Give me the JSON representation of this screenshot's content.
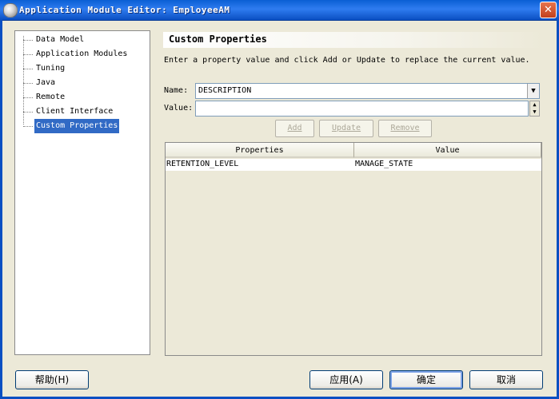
{
  "window": {
    "title": "Application Module Editor: EmployeeAM",
    "close_glyph": "✕"
  },
  "nav": {
    "items": [
      {
        "label": "Data Model"
      },
      {
        "label": "Application Modules"
      },
      {
        "label": "Tuning"
      },
      {
        "label": "Java"
      },
      {
        "label": "Remote"
      },
      {
        "label": "Client Interface"
      },
      {
        "label": "Custom Properties",
        "selected": true
      }
    ]
  },
  "section": {
    "title": "Custom Properties",
    "instructions": "Enter a property value and click Add or Update to replace the current value."
  },
  "form": {
    "name_label": "Name:",
    "name_value": "DESCRIPTION",
    "value_label": "Value:",
    "value_value": "",
    "dropdown_glyph": "▼",
    "spin_up_glyph": "▲",
    "spin_down_glyph": "▼"
  },
  "actions": {
    "add": "Add",
    "update": "Update",
    "remove": "Remove"
  },
  "table": {
    "columns": [
      "Properties",
      "Value"
    ],
    "rows": [
      [
        "RETENTION_LEVEL",
        "MANAGE_STATE"
      ]
    ]
  },
  "footer": {
    "help": "帮助(H)",
    "apply": "应用(A)",
    "ok": "确定",
    "cancel": "取消"
  }
}
